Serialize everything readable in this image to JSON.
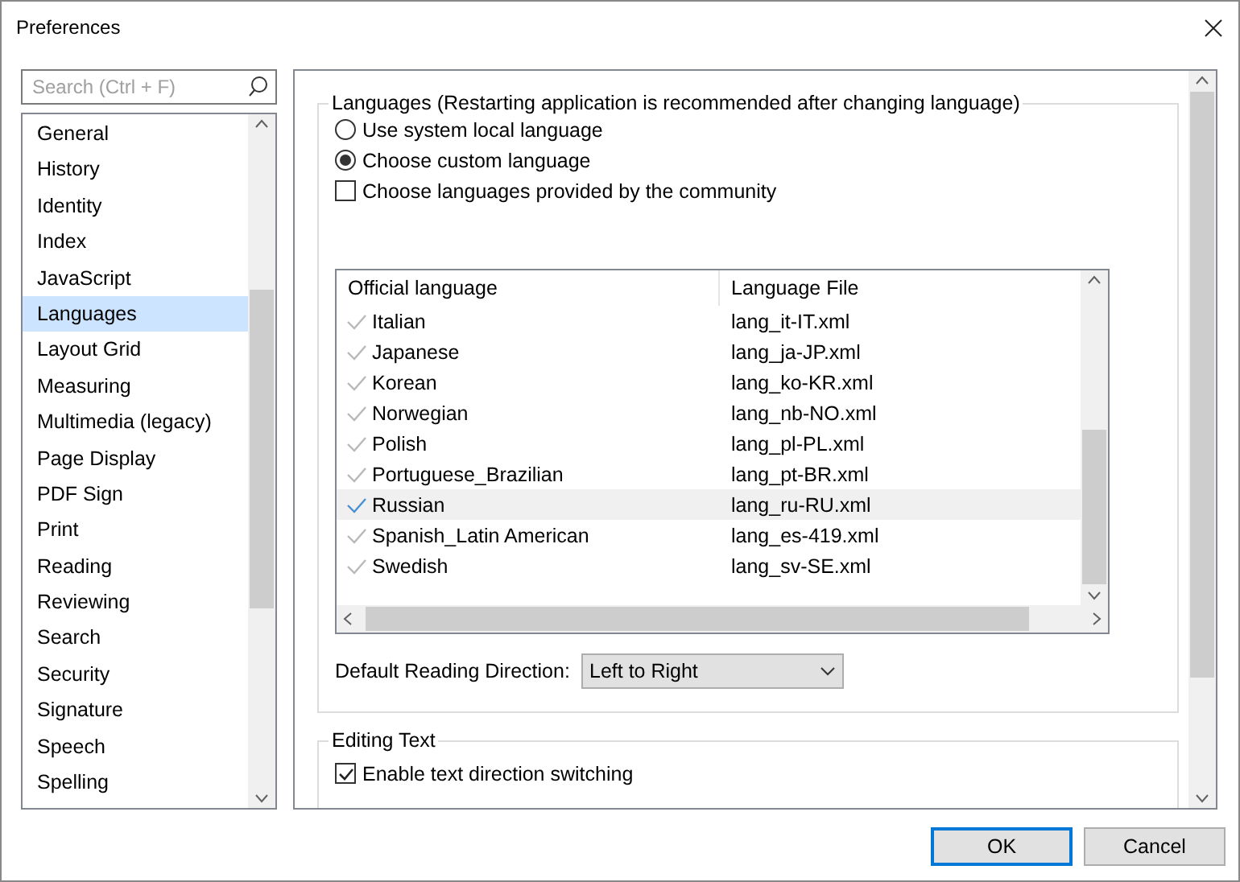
{
  "window": {
    "title": "Preferences"
  },
  "search": {
    "placeholder": "Search (Ctrl + F)"
  },
  "sidebar": {
    "items": [
      {
        "label": "General",
        "selected": false
      },
      {
        "label": "History",
        "selected": false
      },
      {
        "label": "Identity",
        "selected": false
      },
      {
        "label": "Index",
        "selected": false
      },
      {
        "label": "JavaScript",
        "selected": false
      },
      {
        "label": "Languages",
        "selected": true
      },
      {
        "label": "Layout Grid",
        "selected": false
      },
      {
        "label": "Measuring",
        "selected": false
      },
      {
        "label": "Multimedia (legacy)",
        "selected": false
      },
      {
        "label": "Page Display",
        "selected": false
      },
      {
        "label": "PDF Sign",
        "selected": false
      },
      {
        "label": "Print",
        "selected": false
      },
      {
        "label": "Reading",
        "selected": false
      },
      {
        "label": "Reviewing",
        "selected": false
      },
      {
        "label": "Search",
        "selected": false
      },
      {
        "label": "Security",
        "selected": false
      },
      {
        "label": "Signature",
        "selected": false
      },
      {
        "label": "Speech",
        "selected": false
      },
      {
        "label": "Spelling",
        "selected": false
      }
    ]
  },
  "languages": {
    "title": "Languages (Restarting application is recommended after changing language)",
    "options": [
      {
        "kind": "radio",
        "label": "Use system local language",
        "selected": false
      },
      {
        "kind": "radio",
        "label": "Choose custom language",
        "selected": true
      },
      {
        "kind": "checkbox",
        "label": "Choose languages provided by the community",
        "checked": false
      }
    ],
    "table": {
      "columns": [
        "Official language",
        "Language File"
      ],
      "rows": [
        {
          "language": "Italian",
          "file": "lang_it-IT.xml",
          "selected": false
        },
        {
          "language": "Japanese",
          "file": "lang_ja-JP.xml",
          "selected": false
        },
        {
          "language": "Korean",
          "file": "lang_ko-KR.xml",
          "selected": false
        },
        {
          "language": "Norwegian",
          "file": "lang_nb-NO.xml",
          "selected": false
        },
        {
          "language": "Polish",
          "file": "lang_pl-PL.xml",
          "selected": false
        },
        {
          "language": "Portuguese_Brazilian",
          "file": "lang_pt-BR.xml",
          "selected": false
        },
        {
          "language": "Russian",
          "file": "lang_ru-RU.xml",
          "selected": true
        },
        {
          "language": "Spanish_Latin American",
          "file": "lang_es-419.xml",
          "selected": false
        },
        {
          "language": "Swedish",
          "file": "lang_sv-SE.xml",
          "selected": false
        }
      ]
    },
    "reading_direction": {
      "label": "Default Reading Direction:",
      "value": "Left to Right"
    }
  },
  "editing_text": {
    "title": "Editing Text",
    "options": [
      {
        "label": "Enable text direction switching",
        "checked": true
      }
    ]
  },
  "buttons": [
    {
      "label": "OK",
      "default": true
    },
    {
      "label": "Cancel",
      "default": false
    }
  ]
}
